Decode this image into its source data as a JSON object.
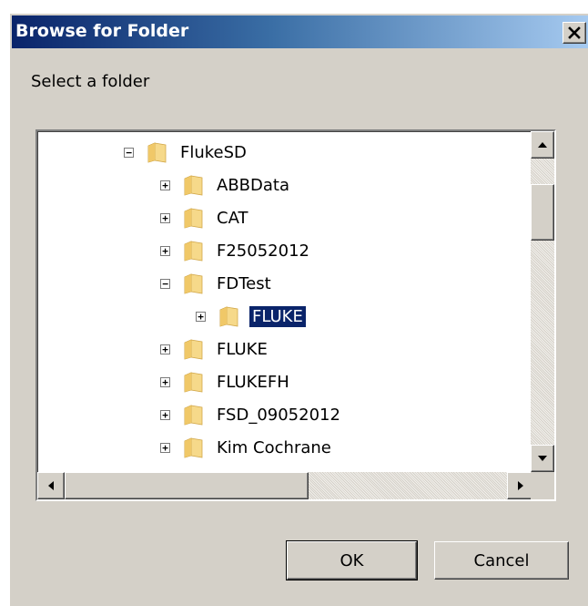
{
  "window": {
    "title": "Browse for Folder",
    "close_glyph": "✕"
  },
  "prompt": "Select a folder",
  "tree": {
    "items": [
      {
        "label": "FlukeSD",
        "expander": "−",
        "expanded": true,
        "selected": false
      },
      {
        "label": "ABBData",
        "expander": "+",
        "expanded": false,
        "selected": false
      },
      {
        "label": "CAT",
        "expander": "+",
        "expanded": false,
        "selected": false
      },
      {
        "label": "F25052012",
        "expander": "+",
        "expanded": false,
        "selected": false
      },
      {
        "label": "FDTest",
        "expander": "−",
        "expanded": true,
        "selected": false
      },
      {
        "label": "FLUKE",
        "expander": "+",
        "expanded": false,
        "selected": true
      },
      {
        "label": "FLUKE",
        "expander": "+",
        "expanded": false,
        "selected": false
      },
      {
        "label": "FLUKEFH",
        "expander": "+",
        "expanded": false,
        "selected": false
      },
      {
        "label": "FSD_09052012",
        "expander": "+",
        "expanded": false,
        "selected": false
      },
      {
        "label": "Kim Cochrane",
        "expander": "+",
        "expanded": false,
        "selected": false
      }
    ]
  },
  "buttons": {
    "ok": "OK",
    "cancel": "Cancel"
  },
  "icons": {
    "folder": "folder-icon",
    "close": "close-icon",
    "scroll_up": "scroll-up-icon",
    "scroll_down": "scroll-down-icon",
    "scroll_left": "scroll-left-icon",
    "scroll_right": "scroll-right-icon"
  },
  "colors": {
    "title_bar_start": "#0a246a",
    "title_bar_end": "#a6caf0",
    "dialog_bg": "#d4d0c8",
    "selection_bg": "#0a246a",
    "folder": "#f4d27a"
  }
}
